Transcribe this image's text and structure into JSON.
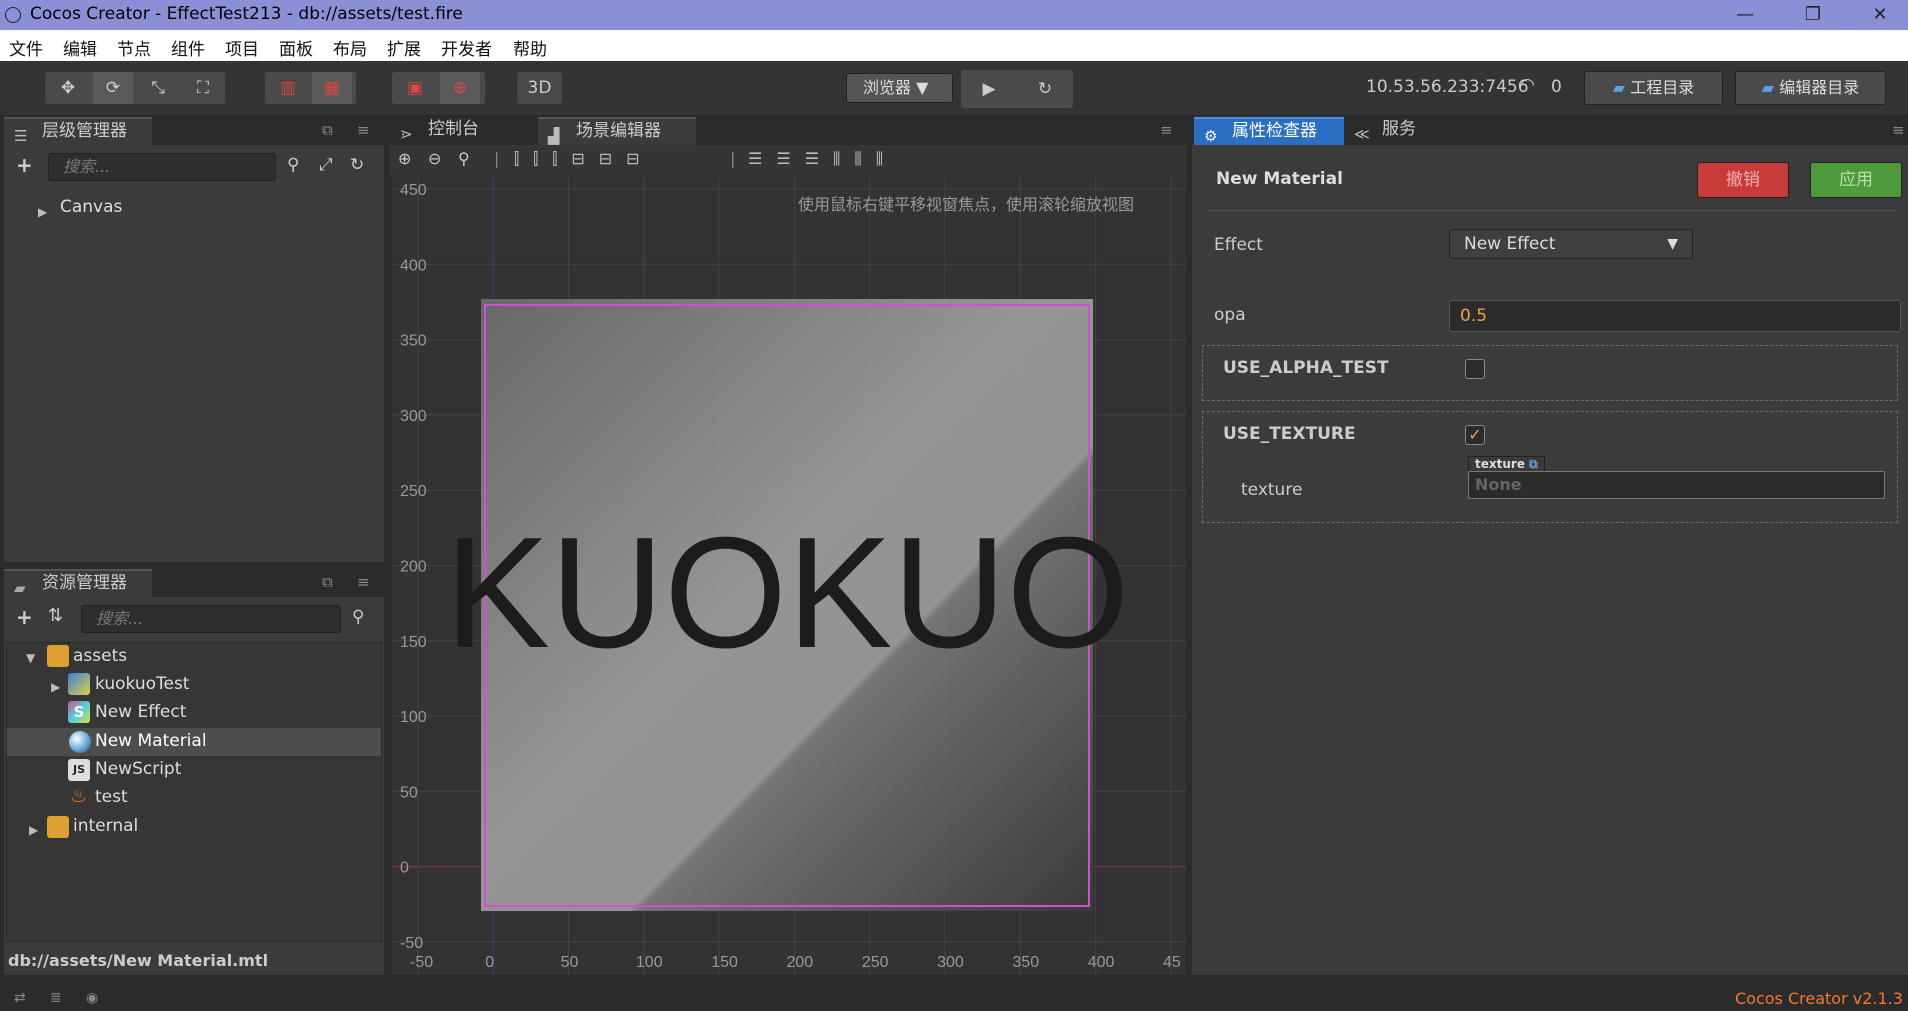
{
  "window": {
    "title": "Cocos Creator - EffectTest213 - db://assets/test.fire"
  },
  "menu": [
    "文件",
    "编辑",
    "节点",
    "组件",
    "项目",
    "面板",
    "布局",
    "扩展",
    "开发者",
    "帮助"
  ],
  "toolbar": {
    "btn_3d": "3D",
    "browser": "浏览器 ▼",
    "ip": "10.53.56.233:7456",
    "wifi_count": "0",
    "project_dir": "工程目录",
    "editor_dir": "编辑器目录"
  },
  "hierarchy": {
    "title": "层级管理器",
    "search_placeholder": "搜索...",
    "root": "Canvas"
  },
  "assets": {
    "title": "资源管理器",
    "search_placeholder": "搜索...",
    "items": [
      {
        "label": "assets"
      },
      {
        "label": "kuokuoTest"
      },
      {
        "label": "New Effect"
      },
      {
        "label": "New Material"
      },
      {
        "label": "NewScript"
      },
      {
        "label": "test"
      },
      {
        "label": "internal"
      }
    ],
    "status_path": "db://assets/New Material.mtl"
  },
  "scene": {
    "tab_console": "控制台",
    "tab_scene": "场景编辑器",
    "hint": "使用鼠标右键平移视窗焦点，使用滚轮缩放视图",
    "y_ticks": [
      "450",
      "400",
      "350",
      "300",
      "250",
      "200",
      "150",
      "100",
      "50",
      "0",
      "-50"
    ],
    "x_ticks": [
      "-50",
      "0",
      "50",
      "100",
      "150",
      "200",
      "250",
      "300",
      "350",
      "400",
      "45"
    ],
    "sprite_text": "KUOKUO"
  },
  "inspector": {
    "tab_inspector": "属性检查器",
    "tab_services": "服务",
    "asset_name": "New Material",
    "revert_label": "撤销",
    "apply_label": "应用",
    "effect_label": "Effect",
    "effect_value": "New Effect",
    "opa_label": "opa",
    "opa_value": "0.5",
    "use_alpha_test": {
      "label": "USE_ALPHA_TEST",
      "checked": false
    },
    "use_texture": {
      "label": "USE_TEXTURE",
      "checked": true
    },
    "texture_label": "texture",
    "texture_tag": "texture",
    "texture_value": "None"
  },
  "status": {
    "version": "Cocos Creator v2.1.3"
  },
  "colors": {
    "accent": "#f0a24a",
    "tab_blue": "#2a6fc3",
    "revert": "#c93a3a",
    "apply": "#4f9a3c"
  }
}
